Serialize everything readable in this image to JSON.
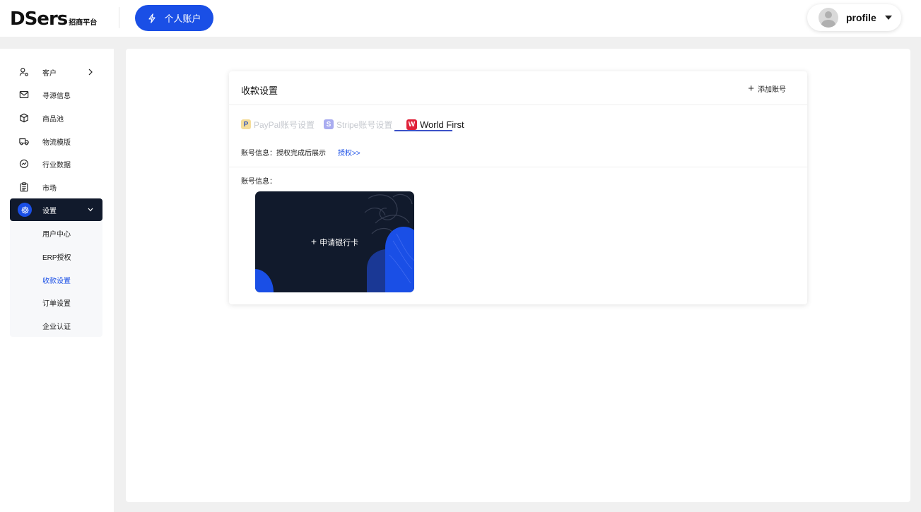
{
  "header": {
    "logo_main": "DSers",
    "logo_sub": "招商平台",
    "personal_account_label": "个人账户",
    "profile_name": "profile"
  },
  "sidebar": {
    "items": [
      {
        "label": "客户",
        "icon": "user-icon",
        "has_chevron": true
      },
      {
        "label": "寻源信息",
        "icon": "mail-icon"
      },
      {
        "label": "商品池",
        "icon": "box-icon"
      },
      {
        "label": "物流模版",
        "icon": "truck-icon"
      },
      {
        "label": "行业数据",
        "icon": "chart-circle-icon"
      },
      {
        "label": "市场",
        "icon": "clipboard-icon"
      },
      {
        "label": "设置",
        "icon": "gear-icon",
        "active": true,
        "expanded": true
      }
    ],
    "settings_submenu": [
      {
        "label": "用户中心"
      },
      {
        "label": "ERP授权"
      },
      {
        "label": "收款设置",
        "active": true
      },
      {
        "label": "订单设置"
      },
      {
        "label": "企业认证"
      }
    ]
  },
  "payment_card": {
    "title": "收款设置",
    "add_account_label": "添加账号",
    "tabs": [
      {
        "label": "PayPal账号设置",
        "icon": "paypal-icon",
        "active": false
      },
      {
        "label": "Stripe账号设置",
        "icon": "stripe-icon",
        "active": false
      },
      {
        "label": "World First",
        "icon": "worldfirst-icon",
        "active": true
      }
    ],
    "account_info_label": "账号信息：",
    "account_info_value": "授权完成后展示",
    "authorize_link": "授权>>",
    "account_info_label2": "账号信息：",
    "apply_bank_card_label": "申请银行卡"
  },
  "colors": {
    "accent": "#1a4fe6",
    "sidebar_active_bg": "#111a2c",
    "worldfirst_red": "#e0223a"
  }
}
